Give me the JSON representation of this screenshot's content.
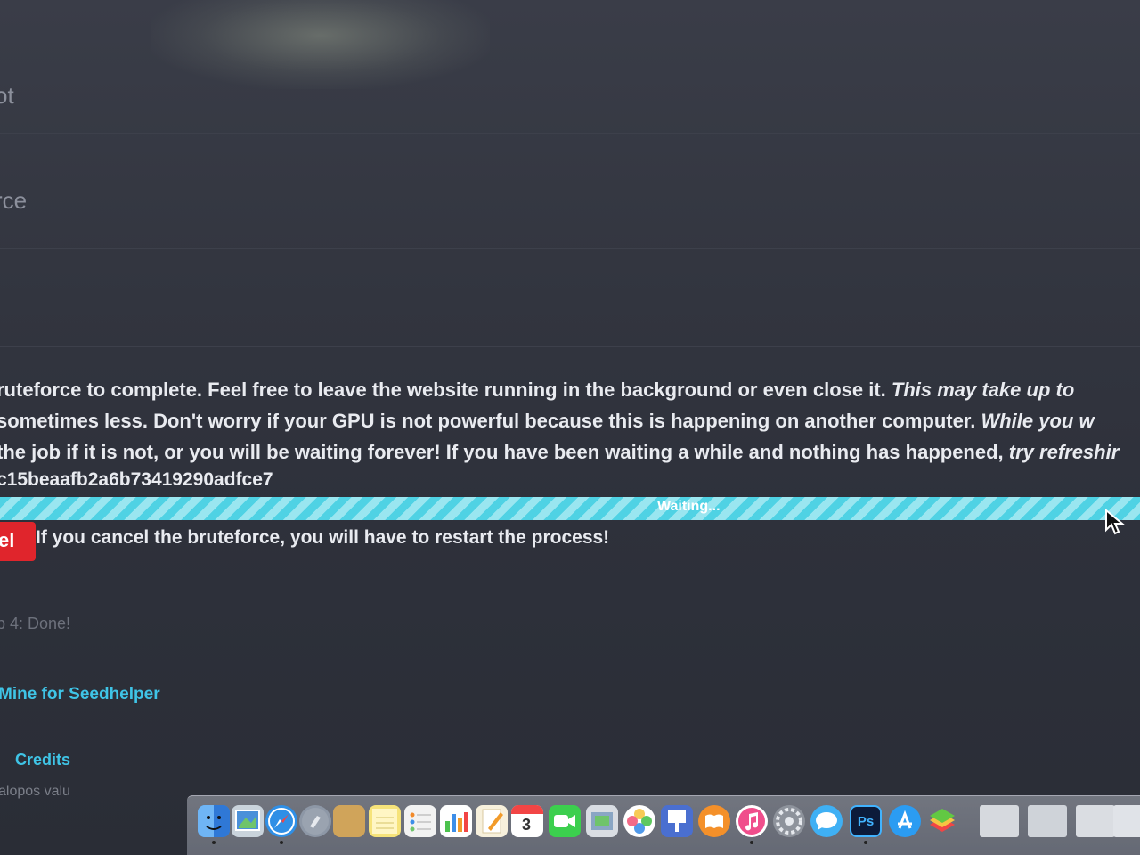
{
  "menu": {
    "row1_label": "ot",
    "row2_label": "rce"
  },
  "bruteforce": {
    "description_line1_normal": "ruteforce to complete. Feel free to leave the website running in the background or even close it. ",
    "description_line1_italic": "This may take up to",
    "description_line2_normal": " sometimes less. Don't worry if your GPU is not powerful because this is happening on another computer. ",
    "description_line2_italic": "While you w",
    "description_line3_normal": "the job if it is not, or you will be waiting forever! If you have been waiting a while and nothing has happened, ",
    "description_line3_italic": "try refreshir",
    "hash": "c15beaafb2a6b73419290adfce7",
    "progress_label": "Waiting...",
    "progress_fraction": 1.0,
    "cancel_button_label": "el",
    "cancel_warning": "If you cancel the bruteforce, you will have to restart the process!"
  },
  "steps": {
    "step4_label": "p 4: Done!"
  },
  "links": {
    "mine_label": "Mine for Seedhelper",
    "credits_label": "Credits"
  },
  "footer": {
    "cutoff_text": "alopos valu"
  },
  "dock": {
    "photoshop_label": "Ps",
    "calendar_day": "3",
    "colors": {
      "finder": "#3d8ee8",
      "safari": "#2f8fe6",
      "launchpad": "#8d97a6",
      "notes": "#f6d34a",
      "numbers": "#4cc24e",
      "pages": "#f29b2a",
      "calendar": "#ffffff",
      "facetime": "#3ccf4e",
      "photos": "#f25a7a",
      "ibooks": "#f4902a",
      "itunes": "#f04e8c",
      "system_prefs": "#8e939c",
      "messages": "#3fb0f4",
      "photoshop": "#0c1b3a",
      "appstore": "#2b9cf2",
      "bluestacks": "#62c843"
    }
  }
}
